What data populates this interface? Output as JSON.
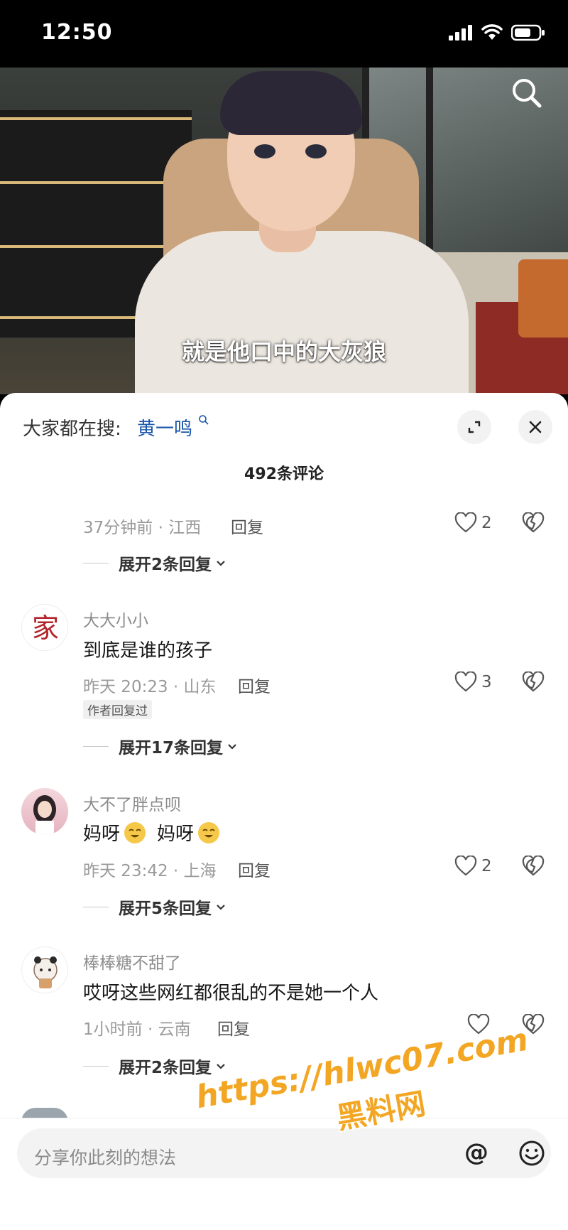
{
  "status_bar": {
    "time": "12:50"
  },
  "video": {
    "subtitle": "就是他口中的大灰狼"
  },
  "sheet": {
    "trending_label": "大家都在搜:",
    "trending_term": "黄一鸣",
    "comment_count": "492条评论"
  },
  "comments": [
    {
      "name": "",
      "text": "",
      "time": "37分钟前 · 江西",
      "reply": "回复",
      "likes": "2",
      "expand": "展开2条回复"
    },
    {
      "name": "大大小小",
      "text": "到底是谁的孩子",
      "time": "昨天 20:23 · 山东",
      "reply": "回复",
      "likes": "3",
      "tag": "作者回复过",
      "expand": "展开17条回复"
    },
    {
      "name": "大不了胖点呗",
      "text_a": "妈呀",
      "text_b": "妈呀",
      "time": "昨天 23:42 · 上海",
      "reply": "回复",
      "likes": "2",
      "expand": "展开5条回复"
    },
    {
      "name": "棒棒糖不甜了",
      "text": "哎呀这些网红都很乱的不是她一个人",
      "time": "1小时前 · 云南",
      "reply": "回复",
      "likes": "",
      "expand": "展开2条回复"
    }
  ],
  "input": {
    "placeholder": "分享你此刻的想法"
  },
  "watermark": {
    "url": "https://hlwc07.com",
    "name": "黑料网"
  },
  "icons": [
    "signal-icon",
    "wifi-icon",
    "battery-icon",
    "search-icon",
    "collapse-icon",
    "close-icon",
    "heart-icon",
    "broken-heart-icon",
    "chevron-down-icon",
    "at-icon",
    "emoji-icon"
  ]
}
